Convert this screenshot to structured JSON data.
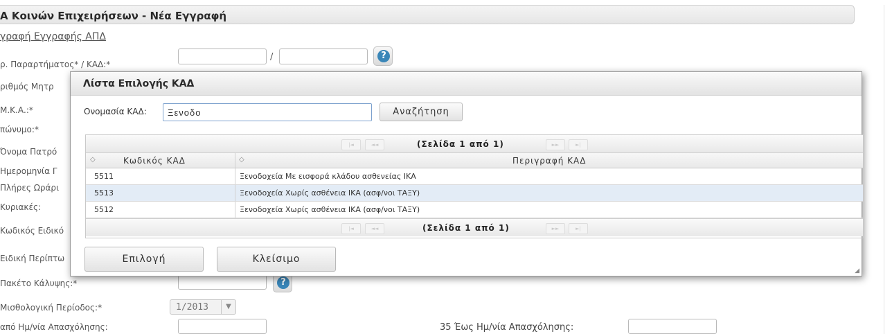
{
  "form": {
    "title": "Α Κοινών Επιχειρήσεων - Νέα Εγγραφή",
    "link": "γραφή Εγγραφής ΑΠΔ",
    "labels": {
      "branch": "ρ. Παραρτήματος* / ΚΑΔ:*",
      "reg": "ριθμός Μητρ",
      "amka": "Μ.Κ.Α.:*",
      "surname": "πώνυμο:*",
      "father": "Όνομα Πατρό",
      "date": "Ημερομηνία Γ",
      "hours": "Πλήρες Ωράρι",
      "sundays": "Κυριακές:",
      "special_code": "Κωδικός Ειδικό",
      "special_case": "Ειδική Περίπτω",
      "package": "Πακέτο Κάλυψης:*",
      "period": "Μισθολογική Περίοδος:*",
      "from_date": "από Ημ/νία Απασχόλησης:",
      "to_date": "35 Έως Ημ/νία Απασχόλησης:"
    },
    "slash": "/",
    "help_glyph": "?",
    "period_value": "1/2013",
    "dropdown_glyph": "▼"
  },
  "dialog": {
    "title": "Λίστα Επιλογής ΚΑΔ",
    "search_label": "Ονομασία ΚΑΔ:",
    "search_value": "Ξενοδο",
    "search_button": "Αναζήτηση",
    "pager_text": "(Σελίδα 1 από 1)",
    "pager_buttons": {
      "first": "|◄",
      "prev": "◄◄",
      "next": "►►",
      "last": "►|"
    },
    "columns": [
      "Κωδικός ΚΑΔ",
      "Περιγραφή ΚΑΔ"
    ],
    "sort_icon": "◇",
    "rows": [
      {
        "code": "5511",
        "desc": "Ξενοδοχεία Με εισφορά κλάδου ασθενείας ΙΚΑ"
      },
      {
        "code": "5513",
        "desc": "Ξενοδοχεία Χωρίς ασθένεια ΙΚΑ (ασφ/νοι ΤΑΞΥ)"
      },
      {
        "code": "5512",
        "desc": "Ξενοδοχεία Χωρίς ασθένεια ΙΚΑ (ασφ/νοι ΤΑΞΥ)"
      }
    ],
    "ok_button": "Επιλογή",
    "close_button": "Κλείσιμο",
    "grip": "◢"
  }
}
